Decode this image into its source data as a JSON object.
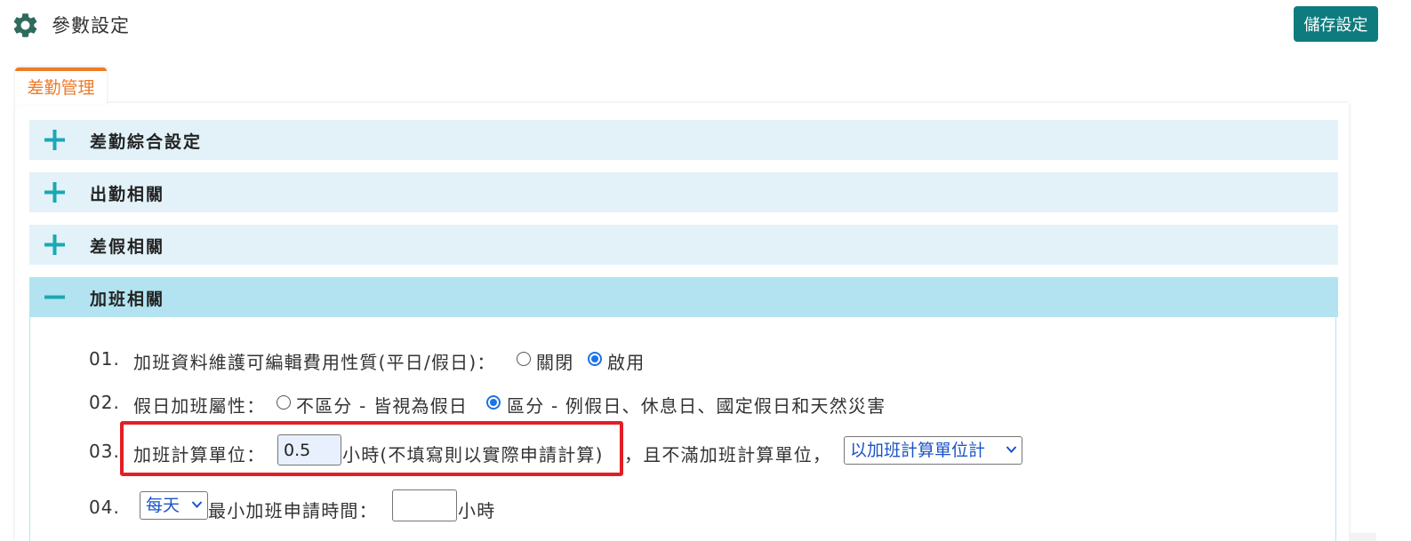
{
  "header": {
    "title": "參數設定",
    "save_label": "儲存設定",
    "icon": "gear-icon"
  },
  "tabs": [
    {
      "label": "差勤管理",
      "active": true
    }
  ],
  "accordion": [
    {
      "label": "差勤綜合設定",
      "expanded": false
    },
    {
      "label": "出勤相關",
      "expanded": false
    },
    {
      "label": "差假相關",
      "expanded": false
    },
    {
      "label": "加班相關",
      "expanded": true
    }
  ],
  "overtime": {
    "row1": {
      "num": "01.",
      "label": "加班資料維護可編輯費用性質(平日/假日)：",
      "opt_off": "關閉",
      "opt_on": "啟用",
      "selected": "啟用"
    },
    "row2": {
      "num": "02.",
      "label": "假日加班屬性：",
      "opt_a": "不區分 - 皆視為假日",
      "opt_b": "區分 - 例假日、休息日、國定假日和天然災害",
      "selected": "區分 - 例假日、休息日、國定假日和天然災害"
    },
    "row3": {
      "num": "03.",
      "label": "加班計算單位：",
      "value": "0.5",
      "unit_note": "小時(不填寫則以實際申請計算)",
      "tail": "，且不滿加班計算單位，",
      "select_value": "以加班計算單位計"
    },
    "row4": {
      "num": "04.",
      "period_value": "每天",
      "label": "最小加班申請時間：",
      "value": "",
      "unit": "小時"
    }
  },
  "colors": {
    "accent": "#ee7b29",
    "save_button": "#0e7b7e",
    "accordion_bg": "#e2f2f8",
    "accordion_open_bg": "#b3e3f0",
    "plus_icon": "#1aa8b4",
    "highlight_border": "#e31e25",
    "radio_checked": "#1a73e8"
  }
}
